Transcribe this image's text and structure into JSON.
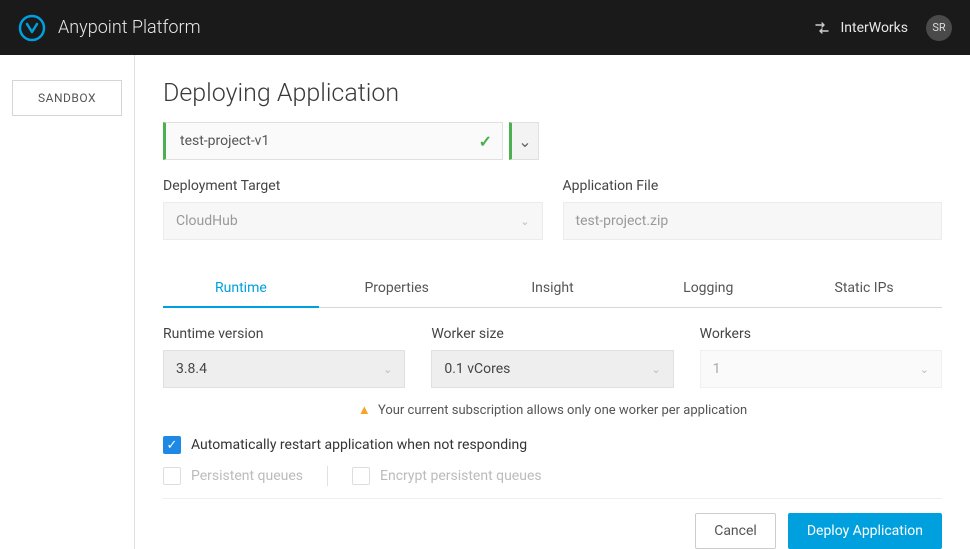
{
  "header": {
    "platform_title": "Anypoint Platform",
    "org_name": "InterWorks",
    "avatar_initials": "SR"
  },
  "sidebar": {
    "env_label": "SANDBOX"
  },
  "page": {
    "title": "Deploying Application",
    "app_name": "test-project-v1",
    "deployment_target_label": "Deployment Target",
    "deployment_target_value": "CloudHub",
    "application_file_label": "Application File",
    "application_file_value": "test-project.zip"
  },
  "tabs": [
    "Runtime",
    "Properties",
    "Insight",
    "Logging",
    "Static IPs"
  ],
  "runtime": {
    "runtime_version_label": "Runtime version",
    "runtime_version_value": "3.8.4",
    "worker_size_label": "Worker size",
    "worker_size_value": "0.1 vCores",
    "workers_label": "Workers",
    "workers_value": "1",
    "warning_text": "Your current subscription allows only one worker per application",
    "auto_restart_label": "Automatically restart application when not responding",
    "persistent_queues_label": "Persistent queues",
    "encrypt_queues_label": "Encrypt persistent queues"
  },
  "footer": {
    "cancel_label": "Cancel",
    "deploy_label": "Deploy Application"
  }
}
